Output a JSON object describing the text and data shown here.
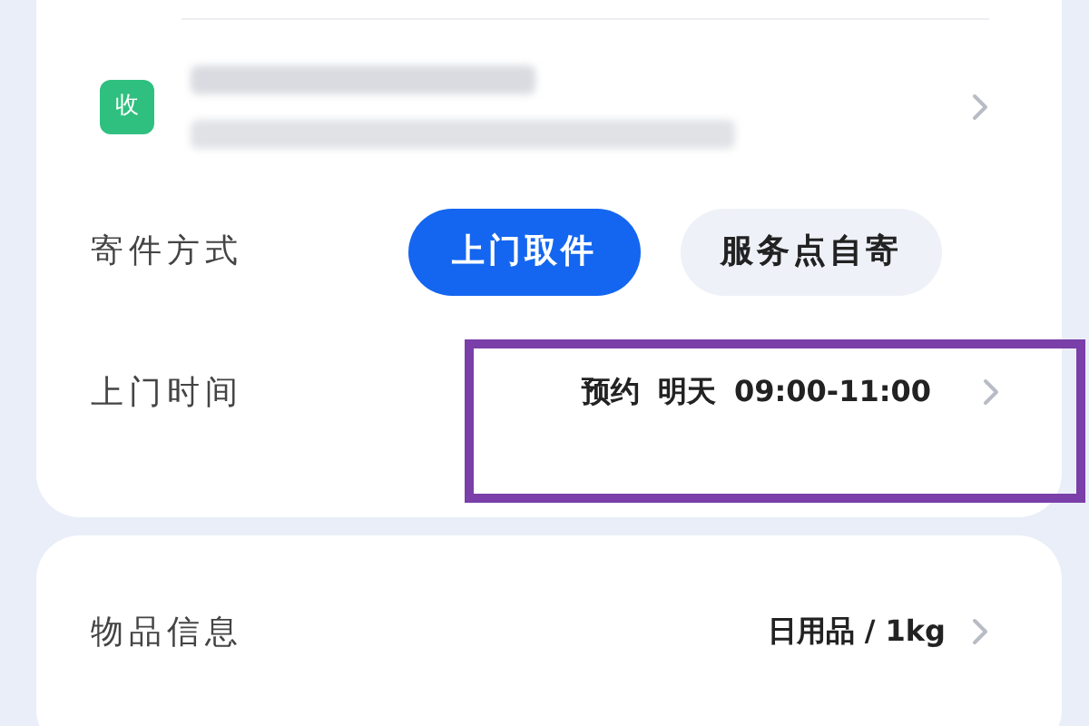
{
  "address": {
    "badge": "收"
  },
  "ship_method": {
    "label": "寄件方式",
    "options": [
      {
        "label": "上门取件",
        "selected": true
      },
      {
        "label": "服务点自寄",
        "selected": false
      }
    ]
  },
  "pickup_time": {
    "label": "上门时间",
    "value": [
      "预约",
      "明天",
      "09:00-11:00"
    ],
    "highlighted": true
  },
  "item_info": {
    "label": "物品信息",
    "value": "日用品 / 1kg"
  }
}
